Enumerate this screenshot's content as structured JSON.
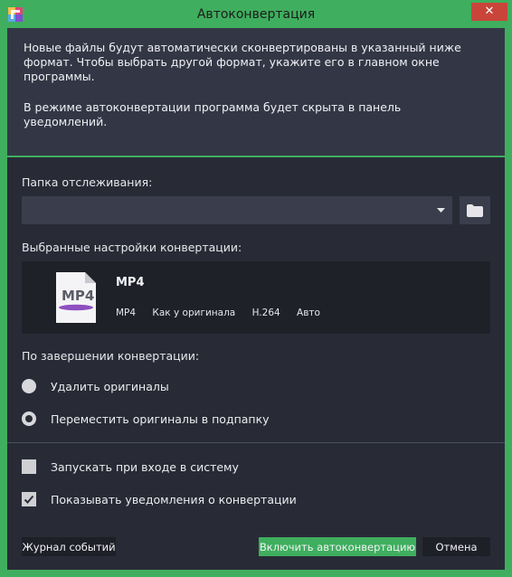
{
  "window": {
    "title": "Автоконвертация",
    "close_glyph": "✕"
  },
  "info": {
    "paragraph1": "Новые файлы будут автоматически сконвертированы в указанный ниже формат. Чтобы выбрать другой формат, укажите его в главном окне программы.",
    "paragraph2": "В режиме автоконвертации программа будет скрыта в панель уведомлений."
  },
  "watch_folder": {
    "label": "Папка отслеживания:",
    "value": ""
  },
  "conversion_settings": {
    "label": "Выбранные настройки конвертации:",
    "icon_text": "MP4",
    "name": "MP4",
    "format": "MP4",
    "resolution": "Как у оригинала",
    "codec": "H.264",
    "bitrate": "Авто"
  },
  "after_conversion": {
    "label": "По завершении конвертации:",
    "options": [
      {
        "label": "Удалить оригиналы",
        "selected": false
      },
      {
        "label": "Переместить оригиналы в подпапку",
        "selected": true
      }
    ]
  },
  "options": {
    "run_at_login": {
      "label": "Запускать при входе в систему",
      "checked": false
    },
    "show_notifications": {
      "label": "Показывать уведомления о конвертации",
      "checked": true
    }
  },
  "buttons": {
    "event_log": "Журнал событий",
    "enable": "Включить автоконвертацию",
    "cancel": "Отмена"
  },
  "colors": {
    "accent": "#3fae5e",
    "background": "#282b36",
    "panel": "#333745",
    "close": "#c9453a"
  }
}
